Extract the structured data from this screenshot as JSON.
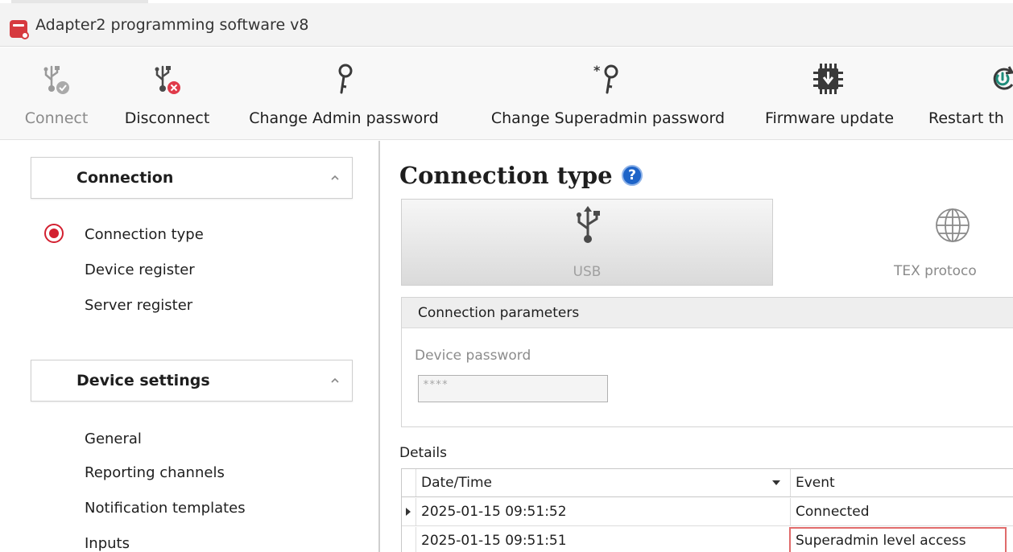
{
  "window": {
    "title": "Adapter2 programming software v8"
  },
  "toolbar": {
    "buttons": [
      {
        "label": "Connect",
        "icon": "usb-check-icon",
        "enabled": false
      },
      {
        "label": "Disconnect",
        "icon": "usb-disconnect-icon",
        "enabled": true
      },
      {
        "label": "Change Admin password",
        "icon": "key-icon",
        "enabled": true
      },
      {
        "label": "Change Superadmin password",
        "icon": "key-star-icon",
        "enabled": true
      },
      {
        "label": "Firmware update",
        "icon": "chip-download-icon",
        "enabled": true
      },
      {
        "label": "Restart th",
        "icon": "restart-power-icon",
        "enabled": true
      }
    ]
  },
  "sidebar": {
    "groups": [
      {
        "title": "Connection",
        "items": [
          "Connection type",
          "Device register",
          "Server register"
        ],
        "selected": "Connection type"
      },
      {
        "title": "Device settings",
        "items": [
          "General",
          "Reporting channels",
          "Notification templates",
          "Inputs"
        ]
      }
    ]
  },
  "main": {
    "title": "Connection type",
    "help_icon": "?",
    "tiles": [
      {
        "label": "USB",
        "icon": "usb-icon",
        "selected": true
      },
      {
        "label": "TEX protoco",
        "icon": "globe-icon",
        "selected": false
      }
    ],
    "params": {
      "header": "Connection parameters",
      "password_label": "Device password",
      "password_value": "****"
    },
    "details": {
      "label": "Details",
      "columns": [
        "Date/Time",
        "Event"
      ],
      "rows": [
        {
          "datetime": "2025-01-15 09:51:52",
          "event": "Connected"
        },
        {
          "datetime": "2025-01-15 09:51:51",
          "event": "Superadmin level access"
        }
      ]
    }
  },
  "colors": {
    "accent_red": "#d32030",
    "help_blue": "#1e64c8",
    "highlight_border": "#e06b6b"
  }
}
